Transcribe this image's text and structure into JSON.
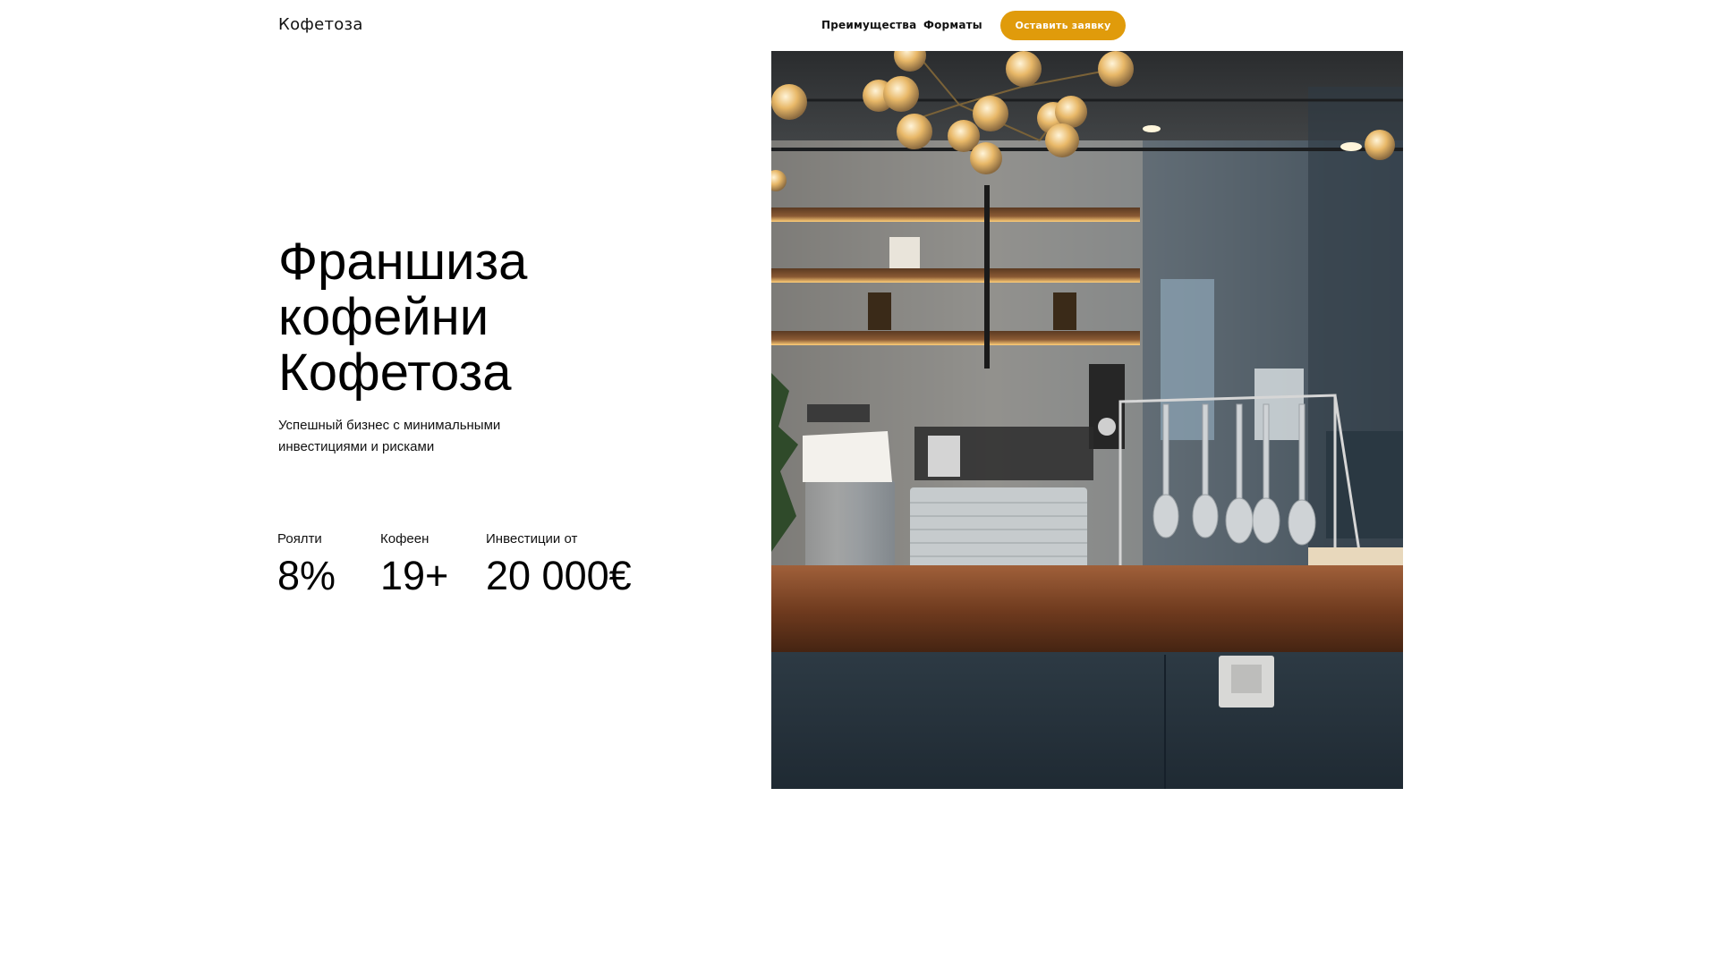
{
  "header": {
    "logo": "Кофетоза",
    "nav": [
      "Преимущества",
      "Форматы"
    ],
    "cta_label": "Оставить заявку"
  },
  "hero": {
    "title_lines": [
      "Франшиза",
      "кофейни",
      "Кофетоза"
    ],
    "subtitle_lines": [
      "Успешный бизнес с минимальными",
      "инвестициями и рисками"
    ],
    "stats": [
      {
        "label": "Роялти",
        "value": "8%"
      },
      {
        "label": "Кофеен",
        "value": "19+"
      },
      {
        "label": "Инвестиции от",
        "value": "20 000€"
      }
    ]
  },
  "colors": {
    "accent": "#e09b0b",
    "text": "#000000",
    "background": "#ffffff"
  }
}
